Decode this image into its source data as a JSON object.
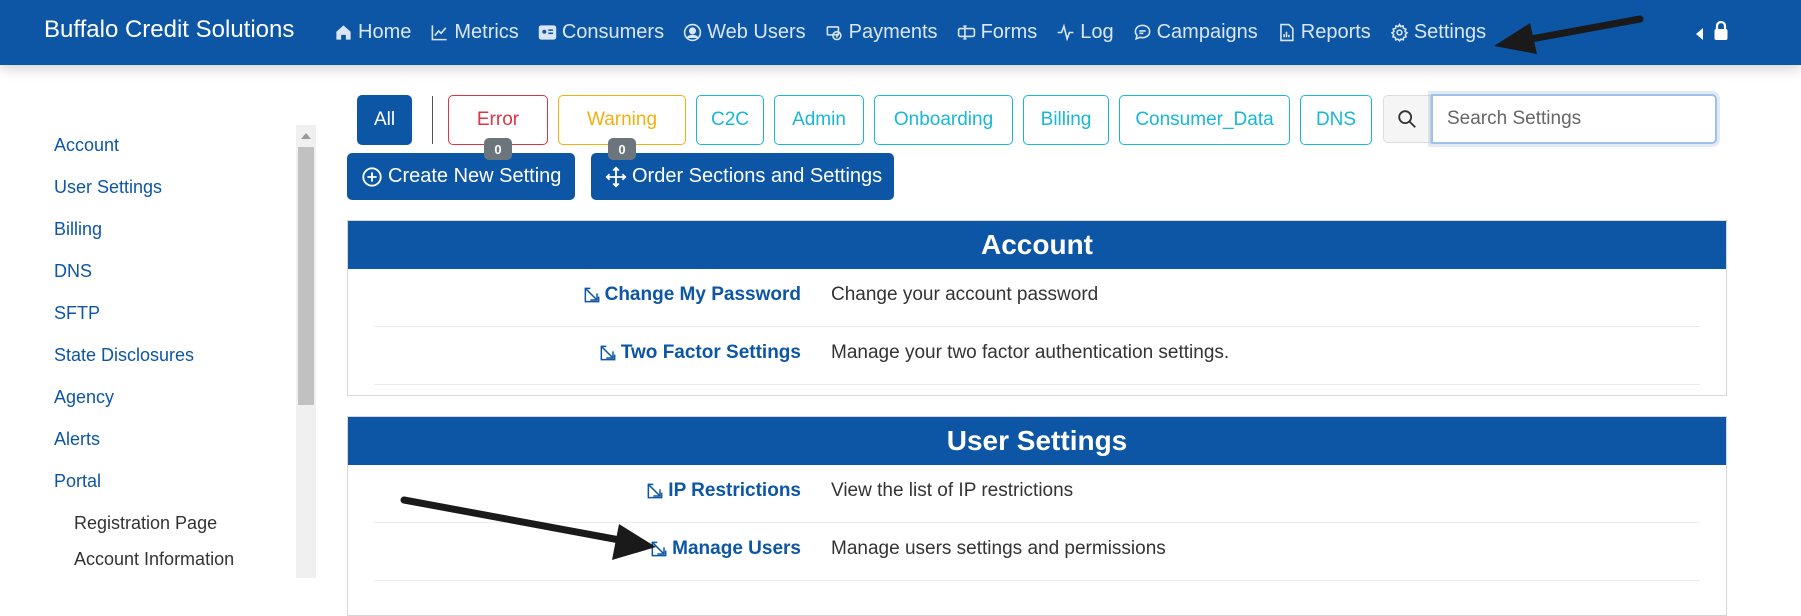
{
  "navbar": {
    "brand": "Buffalo Credit Solutions",
    "items": [
      {
        "label": "Home",
        "icon": "home-icon"
      },
      {
        "label": "Metrics",
        "icon": "chart-icon"
      },
      {
        "label": "Consumers",
        "icon": "id-card-icon"
      },
      {
        "label": "Web Users",
        "icon": "user-circle-icon"
      },
      {
        "label": "Payments",
        "icon": "payments-icon"
      },
      {
        "label": "Forms",
        "icon": "forms-icon"
      },
      {
        "label": "Log",
        "icon": "pulse-icon"
      },
      {
        "label": "Campaigns",
        "icon": "chat-icon"
      },
      {
        "label": "Reports",
        "icon": "report-icon"
      },
      {
        "label": "Settings",
        "icon": "gear-icon"
      }
    ]
  },
  "sidebar": {
    "items": [
      "Account",
      "User Settings",
      "Billing",
      "DNS",
      "SFTP",
      "State Disclosures",
      "Agency",
      "Alerts",
      "Portal"
    ],
    "subitems": [
      "Registration Page",
      "Account Information"
    ]
  },
  "filters": {
    "all": "All",
    "error": "Error",
    "error_count": "0",
    "warning": "Warning",
    "warning_count": "0",
    "tags": [
      "C2C",
      "Admin",
      "Onboarding",
      "Billing",
      "Consumer_Data",
      "DNS"
    ]
  },
  "search": {
    "placeholder": "Search Settings",
    "value": ""
  },
  "actions": {
    "create": "Create New Setting",
    "order": "Order Sections and Settings"
  },
  "sections": [
    {
      "title": "Account",
      "rows": [
        {
          "link": "Change My Password",
          "desc": "Change your account password"
        },
        {
          "link": "Two Factor Settings",
          "desc": "Manage your two factor authentication settings."
        }
      ]
    },
    {
      "title": "User Settings",
      "rows": [
        {
          "link": "IP Restrictions",
          "desc": "View the list of IP restrictions"
        },
        {
          "link": "Manage Users",
          "desc": "Manage users settings and permissions"
        }
      ]
    }
  ],
  "colors": {
    "primary": "#0d56a6",
    "error": "#dc3545",
    "warning": "#f2b00d",
    "info": "#17b8d6",
    "badge": "#6c757d"
  }
}
